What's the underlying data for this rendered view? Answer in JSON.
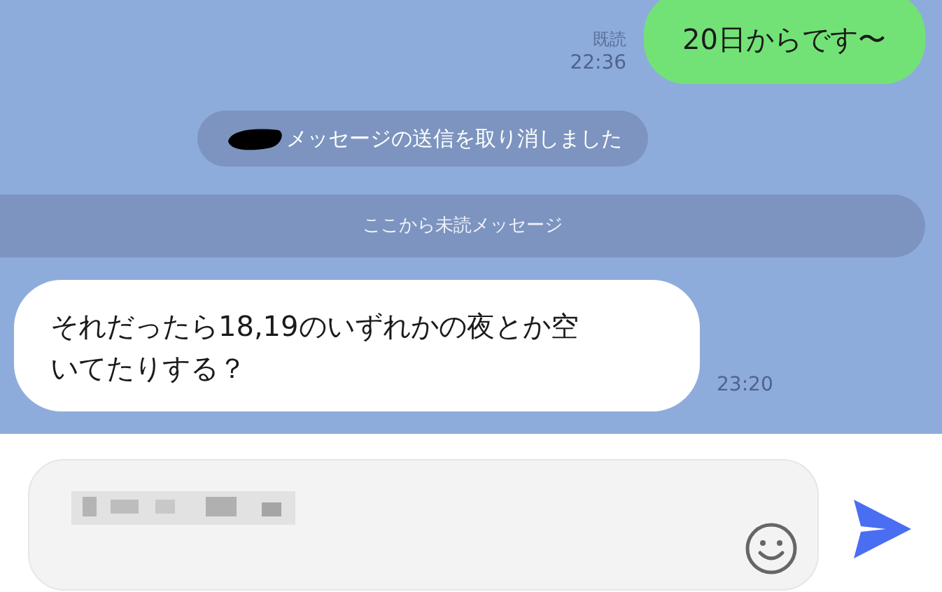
{
  "messages": [
    {
      "kind": "outgoing",
      "text": "20日からです〜",
      "read": "既読",
      "time": "22:36"
    },
    {
      "kind": "system",
      "text": "メッセージの送信を取り消しました",
      "redacted": true
    },
    {
      "kind": "divider",
      "text": "ここから未読メッセージ"
    },
    {
      "kind": "incoming",
      "text": "それだったら18,19のいずれかの夜とか空いてたりする？",
      "time": "23:20"
    }
  ]
}
